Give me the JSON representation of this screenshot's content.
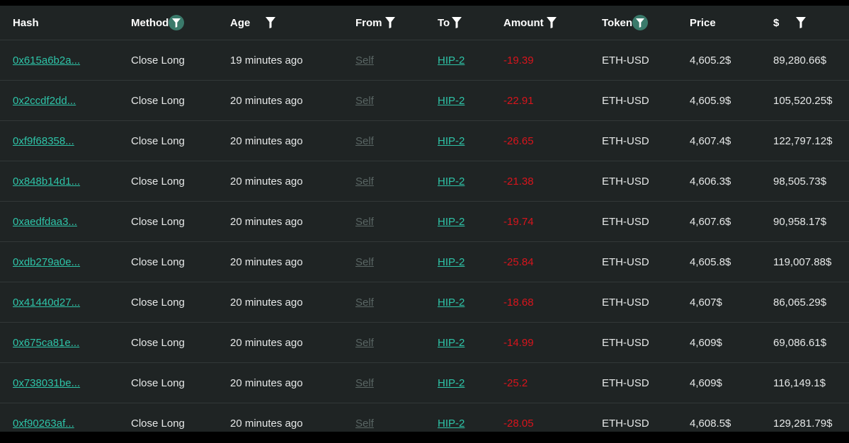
{
  "table": {
    "columns": [
      {
        "key": "hash",
        "label": "Hash",
        "filter": "none"
      },
      {
        "key": "method",
        "label": "Method",
        "filter": "active"
      },
      {
        "key": "age",
        "label": "Age",
        "filter": "plain"
      },
      {
        "key": "from",
        "label": "From",
        "filter": "plain"
      },
      {
        "key": "to",
        "label": "To",
        "filter": "plain"
      },
      {
        "key": "amount",
        "label": "Amount",
        "filter": "plain"
      },
      {
        "key": "token",
        "label": "Token",
        "filter": "active"
      },
      {
        "key": "price",
        "label": "Price",
        "filter": "none"
      },
      {
        "key": "usd",
        "label": "$",
        "filter": "plain"
      }
    ],
    "rows": [
      {
        "hash": "0x615a6b2a...",
        "method": "Close Long",
        "age": "19 minutes ago",
        "from": "Self",
        "to": "HIP-2",
        "amount": "-19.39",
        "token": "ETH-USD",
        "price": "4,605.2$",
        "usd": "89,280.66$"
      },
      {
        "hash": "0x2ccdf2dd...",
        "method": "Close Long",
        "age": "20 minutes ago",
        "from": "Self",
        "to": "HIP-2",
        "amount": "-22.91",
        "token": "ETH-USD",
        "price": "4,605.9$",
        "usd": "105,520.25$"
      },
      {
        "hash": "0xf9f68358...",
        "method": "Close Long",
        "age": "20 minutes ago",
        "from": "Self",
        "to": "HIP-2",
        "amount": "-26.65",
        "token": "ETH-USD",
        "price": "4,607.4$",
        "usd": "122,797.12$"
      },
      {
        "hash": "0x848b14d1...",
        "method": "Close Long",
        "age": "20 minutes ago",
        "from": "Self",
        "to": "HIP-2",
        "amount": "-21.38",
        "token": "ETH-USD",
        "price": "4,606.3$",
        "usd": "98,505.73$"
      },
      {
        "hash": "0xaedfdaa3...",
        "method": "Close Long",
        "age": "20 minutes ago",
        "from": "Self",
        "to": "HIP-2",
        "amount": "-19.74",
        "token": "ETH-USD",
        "price": "4,607.6$",
        "usd": "90,958.17$"
      },
      {
        "hash": "0xdb279a0e...",
        "method": "Close Long",
        "age": "20 minutes ago",
        "from": "Self",
        "to": "HIP-2",
        "amount": "-25.84",
        "token": "ETH-USD",
        "price": "4,605.8$",
        "usd": "119,007.88$"
      },
      {
        "hash": "0x41440d27...",
        "method": "Close Long",
        "age": "20 minutes ago",
        "from": "Self",
        "to": "HIP-2",
        "amount": "-18.68",
        "token": "ETH-USD",
        "price": "4,607$",
        "usd": "86,065.29$"
      },
      {
        "hash": "0x675ca81e...",
        "method": "Close Long",
        "age": "20 minutes ago",
        "from": "Self",
        "to": "HIP-2",
        "amount": "-14.99",
        "token": "ETH-USD",
        "price": "4,609$",
        "usd": "69,086.61$"
      },
      {
        "hash": "0x738031be...",
        "method": "Close Long",
        "age": "20 minutes ago",
        "from": "Self",
        "to": "HIP-2",
        "amount": "-25.2",
        "token": "ETH-USD",
        "price": "4,609$",
        "usd": "116,149.1$"
      },
      {
        "hash": "0xf90263af...",
        "method": "Close Long",
        "age": "20 minutes ago",
        "from": "Self",
        "to": "HIP-2",
        "amount": "-28.05",
        "token": "ETH-USD",
        "price": "4,608.5$",
        "usd": "129,281.79$"
      }
    ]
  },
  "colors": {
    "background": "#1f2424",
    "link": "#2ec4a8",
    "self_link": "#5a6664",
    "negative": "#d9141c",
    "active_filter_badge": "#3a7a6b"
  },
  "icons": {
    "filter": "filter-icon",
    "active_filter": "filter-active-icon"
  }
}
